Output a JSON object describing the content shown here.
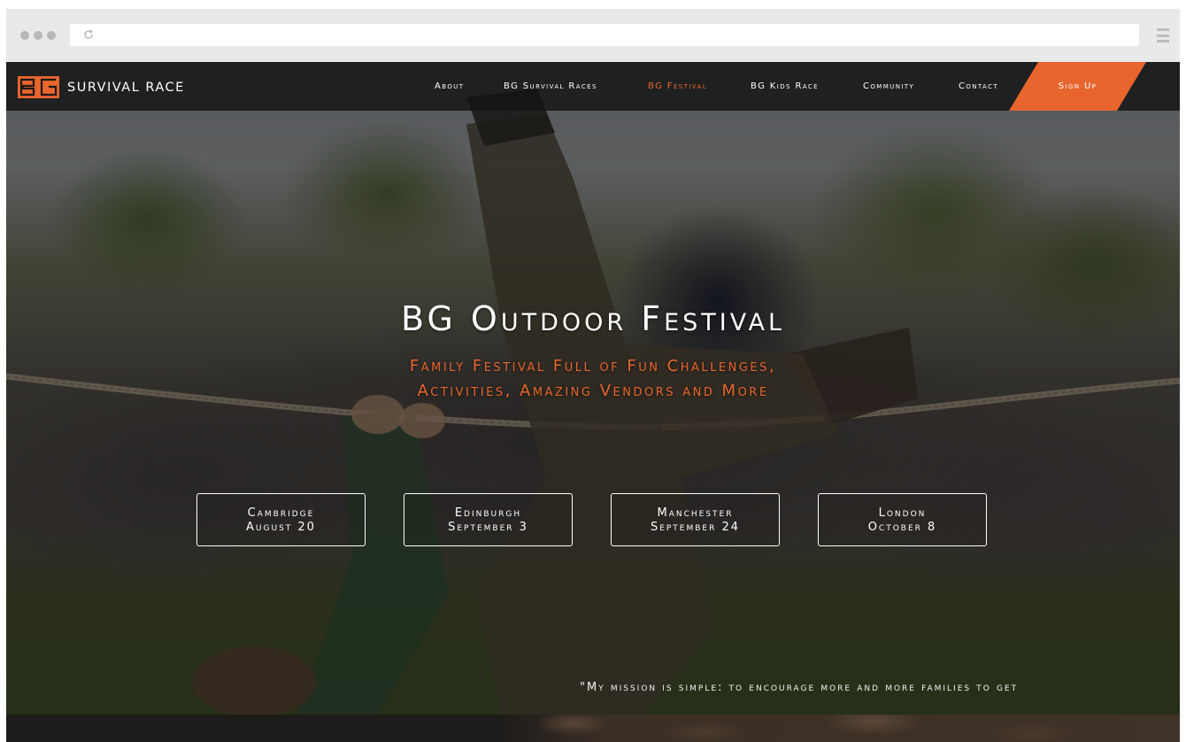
{
  "brand": {
    "logo_text": "SURVIVAL RACE",
    "logo_initials": "BG",
    "accent_color": "#e8652d"
  },
  "nav": {
    "items": [
      {
        "label": "About",
        "active": false
      },
      {
        "label": "BG Survival Races",
        "active": false
      },
      {
        "label": "BG Festival",
        "active": true
      },
      {
        "label": "BG Kids Race",
        "active": false
      },
      {
        "label": "Community",
        "active": false
      },
      {
        "label": "Contact",
        "active": false
      }
    ],
    "signup_label": "Sign Up"
  },
  "hero": {
    "title": "BG Outdoor Festival",
    "subtitle_line1": "Family Festival Full of Fun Challenges,",
    "subtitle_line2": "Activities, Amazing Vendors and More"
  },
  "events": [
    {
      "city": "Cambridge",
      "date": "August 20"
    },
    {
      "city": "Edinburgh",
      "date": "September 3"
    },
    {
      "city": "Manchester",
      "date": "September 24"
    },
    {
      "city": "London",
      "date": "October 8"
    }
  ],
  "footer": {
    "quote": "\"My mission is simple: to encourage more and more families to get"
  },
  "browser": {
    "icons": [
      "window-dots-icon",
      "reload-icon",
      "hamburger-menu-icon"
    ]
  }
}
